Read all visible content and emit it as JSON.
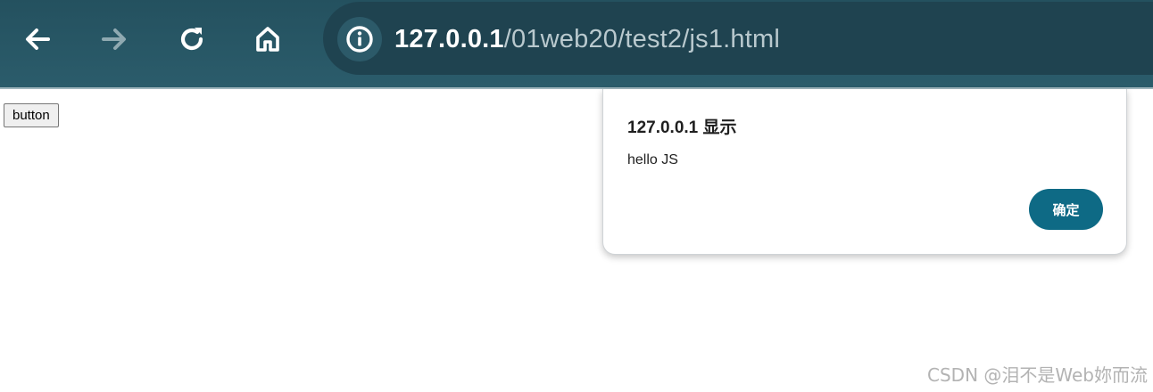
{
  "browser": {
    "url_host": "127.0.0.1",
    "url_path": "/01web20/test2/js1.html",
    "icons": {
      "back": "arrow-left-icon",
      "forward": "arrow-right-icon",
      "reload": "reload-icon",
      "home": "home-icon",
      "site_info": "info-icon"
    },
    "colors": {
      "toolbar": "#2b5c6b",
      "omnibox": "#1f4350"
    }
  },
  "page": {
    "button_label": "button"
  },
  "alert": {
    "title": "127.0.0.1 显示",
    "message": "hello JS",
    "ok_label": "确定",
    "ok_color": "#0e6a85"
  },
  "watermark": "CSDN @泪不是Web妳而流"
}
